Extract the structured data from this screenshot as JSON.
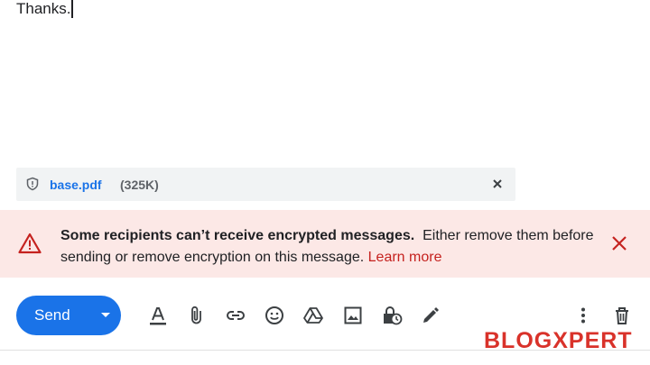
{
  "compose": {
    "body_text": "Thanks."
  },
  "attachment": {
    "name": "base.pdf",
    "size": "(325K)",
    "icon": "shield-icon"
  },
  "warning": {
    "bold_text": "Some recipients can’t receive encrypted messages.",
    "text": "Either remove them before sending or remove encryption on this message.",
    "link_text": "Learn more",
    "color": "#c5221f",
    "background": "#fce8e6"
  },
  "toolbar": {
    "send_label": "Send",
    "accent": "#1a73e8",
    "tools": [
      "formatting-icon",
      "attach-icon",
      "link-icon",
      "emoji-icon",
      "drive-icon",
      "photo-icon",
      "confidential-mode-icon",
      "signature-icon",
      "more-options-icon",
      "discard-icon"
    ]
  },
  "watermark": {
    "text": "BLOGXPERT"
  }
}
